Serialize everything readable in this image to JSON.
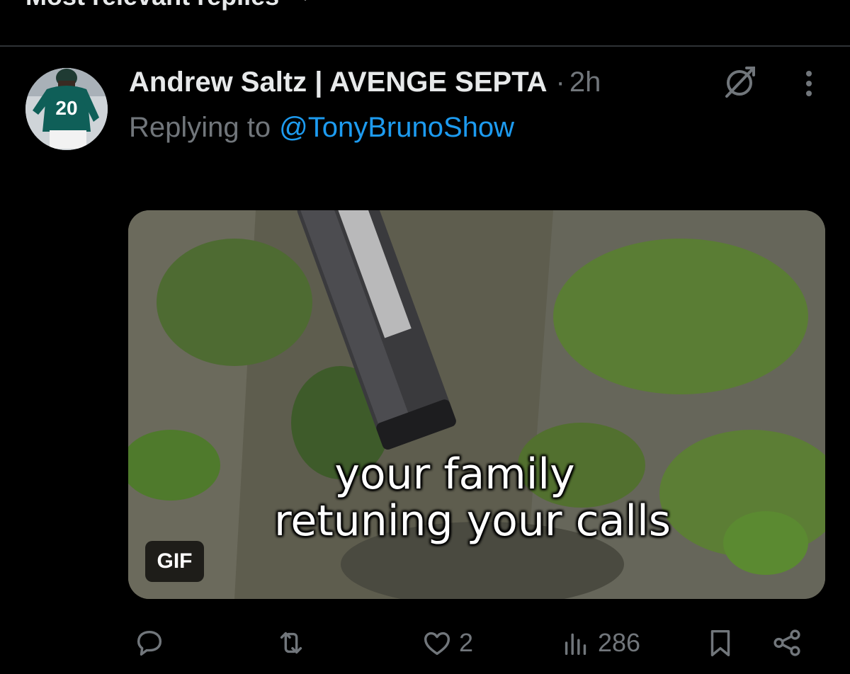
{
  "header": {
    "sort_label": "Most relevant replies"
  },
  "reply": {
    "author": "Andrew Saltz | AVENGE SEPTA",
    "separator": "·",
    "time": "2h",
    "replying_prefix": "Replying to",
    "replying_handle": "@TonyBrunoShow",
    "avatar_jersey_number": "20",
    "media": {
      "caption_line1": "your family",
      "caption_line2": "retuning your calls",
      "badge": "GIF"
    },
    "actions": {
      "reply_icon": "comment-icon",
      "repost_icon": "repost-icon",
      "like_icon": "heart-icon",
      "like_count": "2",
      "views_icon": "views-chart-icon",
      "views_count": "286",
      "bookmark_icon": "bookmark-icon",
      "share_icon": "share-icon"
    }
  },
  "colors": {
    "background": "#000000",
    "text_primary": "#e7e9ea",
    "text_secondary": "#71767b",
    "link": "#1d9bf0",
    "divider": "#2f3336"
  }
}
